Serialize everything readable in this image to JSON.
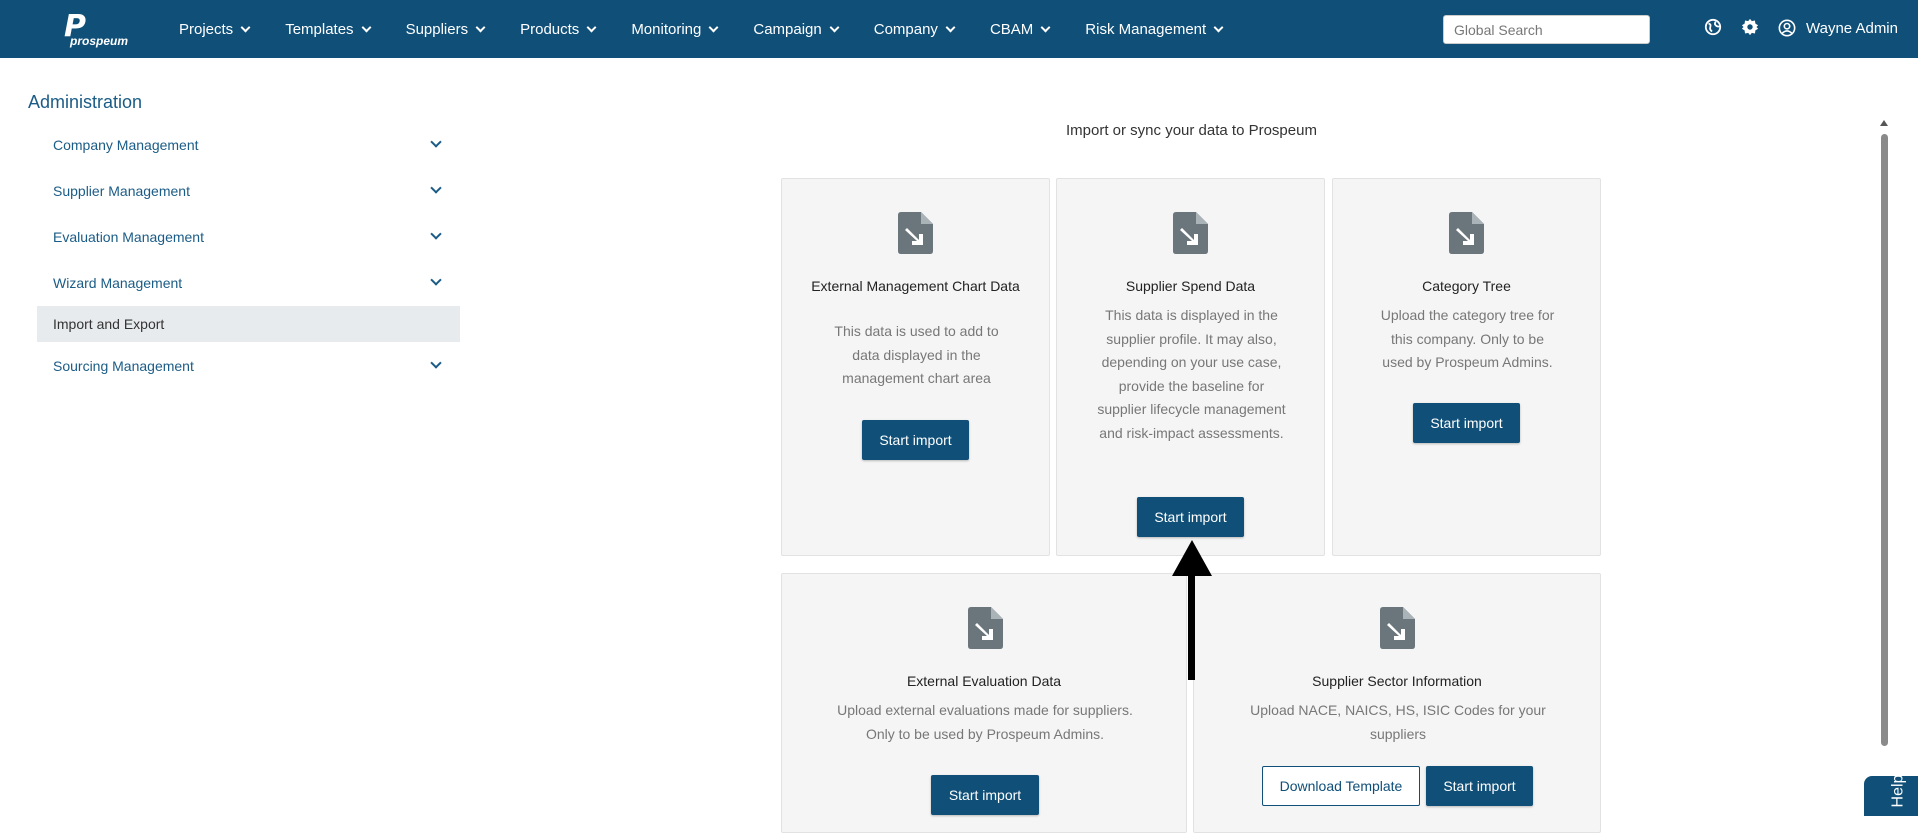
{
  "app": {
    "logo_letter": "P",
    "logo_word": "prospeum"
  },
  "nav": {
    "items": [
      "Projects",
      "Templates",
      "Suppliers",
      "Products",
      "Monitoring",
      "Campaign",
      "Company",
      "CBAM",
      "Risk Management"
    ]
  },
  "search": {
    "placeholder": "Global Search"
  },
  "user": {
    "name": "Wayne Admin"
  },
  "sidebar": {
    "title": "Administration",
    "items": [
      {
        "label": "Company Management",
        "expandable": true
      },
      {
        "label": "Supplier Management",
        "expandable": true
      },
      {
        "label": "Evaluation Management",
        "expandable": true
      },
      {
        "label": "Wizard Management",
        "expandable": true
      },
      {
        "label": "Import and Export",
        "expandable": false,
        "active": true
      },
      {
        "label": "Sourcing Management",
        "expandable": true
      }
    ]
  },
  "main": {
    "title": "Import or sync your data to Prospeum",
    "cards": [
      {
        "title": "External Management Chart Data",
        "description": "This data is used to add to data displayed in the management chart area",
        "button": "Start import"
      },
      {
        "title": "Supplier Spend Data",
        "description": "This data is displayed in the supplier profile. It may also, depending on your use case, provide the baseline for supplier lifecycle management and risk-impact assessments.",
        "button": "Start import"
      },
      {
        "title": "Category Tree",
        "description": "Upload the category tree for this company. Only to be used by Prospeum Admins.",
        "button": "Start import"
      },
      {
        "title": "External Evaluation Data",
        "description": "Upload external evaluations made for suppliers. Only to be used by Prospeum Admins.",
        "button": "Start import"
      },
      {
        "title": "Supplier Sector Information",
        "description": "Upload NACE, NAICS, HS, ISIC Codes for your suppliers",
        "button": "Start import",
        "secondary_button": "Download Template"
      }
    ]
  },
  "help": {
    "label": "Help"
  },
  "colors": {
    "primary": "#0f4f78",
    "card_bg": "#f5f5f5",
    "link": "#1b5c86",
    "active_bg": "#e8ebee"
  },
  "icons": [
    "globe-icon",
    "gear-icon",
    "user-circle-icon",
    "file-import-icon",
    "chevron-down-icon"
  ]
}
